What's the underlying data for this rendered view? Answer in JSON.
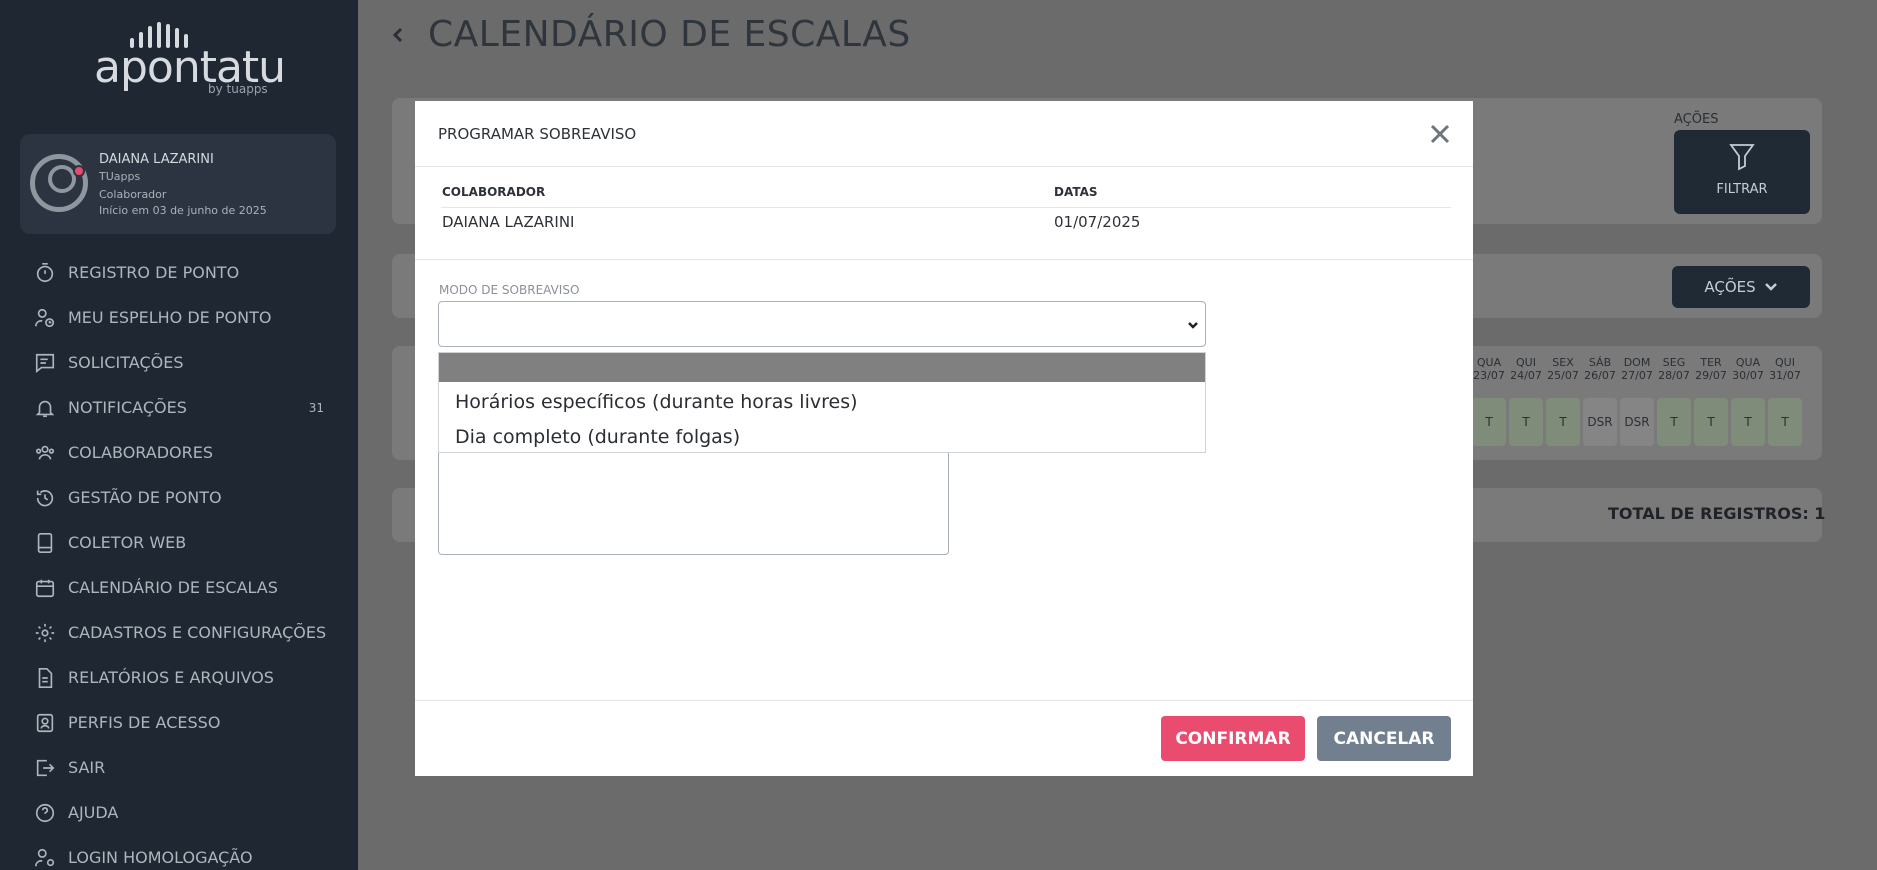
{
  "brand": {
    "name": "apontatu",
    "by": "by tuapps"
  },
  "user": {
    "name": "DAIANA LAZARINI",
    "company": "TUapps",
    "role": "Colaborador",
    "since": "Início em 03 de junho de 2025"
  },
  "sidebar": {
    "items": [
      {
        "label": "REGISTRO DE PONTO",
        "icon": "stopwatch-icon"
      },
      {
        "label": "MEU ESPELHO DE PONTO",
        "icon": "user-clock-icon"
      },
      {
        "label": "SOLICITAÇÕES",
        "icon": "chat-list-icon"
      },
      {
        "label": "NOTIFICAÇÕES",
        "icon": "bell-icon",
        "badge": "31"
      },
      {
        "label": "COLABORADORES",
        "icon": "users-icon"
      },
      {
        "label": "GESTÃO DE PONTO",
        "icon": "history-icon"
      },
      {
        "label": "COLETOR WEB",
        "icon": "tablet-icon"
      },
      {
        "label": "CALENDÁRIO DE ESCALAS",
        "icon": "calendar-icon"
      },
      {
        "label": "CADASTROS E CONFIGURAÇÕES",
        "icon": "gear-icon"
      },
      {
        "label": "RELATÓRIOS E ARQUIVOS",
        "icon": "document-icon"
      },
      {
        "label": "PERFIS DE ACESSO",
        "icon": "id-badge-icon"
      },
      {
        "label": "SAIR",
        "icon": "logout-icon"
      },
      {
        "label": "AJUDA",
        "icon": "help-icon"
      },
      {
        "label": "LOGIN HOMOLOGAÇÃO",
        "icon": "user-gear-icon"
      }
    ]
  },
  "page": {
    "title": "CALENDÁRIO DE ESCALAS",
    "acoes_label": "AÇÕES",
    "filter_label": "FILTRAR",
    "acoes_button": "AÇÕES",
    "total": "TOTAL DE REGISTROS: 1"
  },
  "calendar": {
    "days": [
      {
        "dow": "QUA",
        "date": "23/07",
        "shift": "T"
      },
      {
        "dow": "QUI",
        "date": "24/07",
        "shift": "T"
      },
      {
        "dow": "SEX",
        "date": "25/07",
        "shift": "T"
      },
      {
        "dow": "SÁB",
        "date": "26/07",
        "shift": "DSR"
      },
      {
        "dow": "DOM",
        "date": "27/07",
        "shift": "DSR"
      },
      {
        "dow": "SEG",
        "date": "28/07",
        "shift": "T"
      },
      {
        "dow": "TER",
        "date": "29/07",
        "shift": "T"
      },
      {
        "dow": "QUA",
        "date": "30/07",
        "shift": "T"
      },
      {
        "dow": "QUI",
        "date": "31/07",
        "shift": "T"
      }
    ]
  },
  "modal": {
    "title": "PROGRAMAR SOBREAVISO",
    "col_colaborador": "COLABORADOR",
    "col_datas": "DATAS",
    "row_colaborador": "DAIANA LAZARINI",
    "row_datas": "01/07/2025",
    "mode_label": "MODO DE SOBREAVISO",
    "mode_value": "",
    "options": [
      "",
      "Horários específicos (durante horas livres)",
      "Dia completo (durante folgas)"
    ],
    "confirm": "CONFIRMAR",
    "cancel": "CANCELAR"
  }
}
